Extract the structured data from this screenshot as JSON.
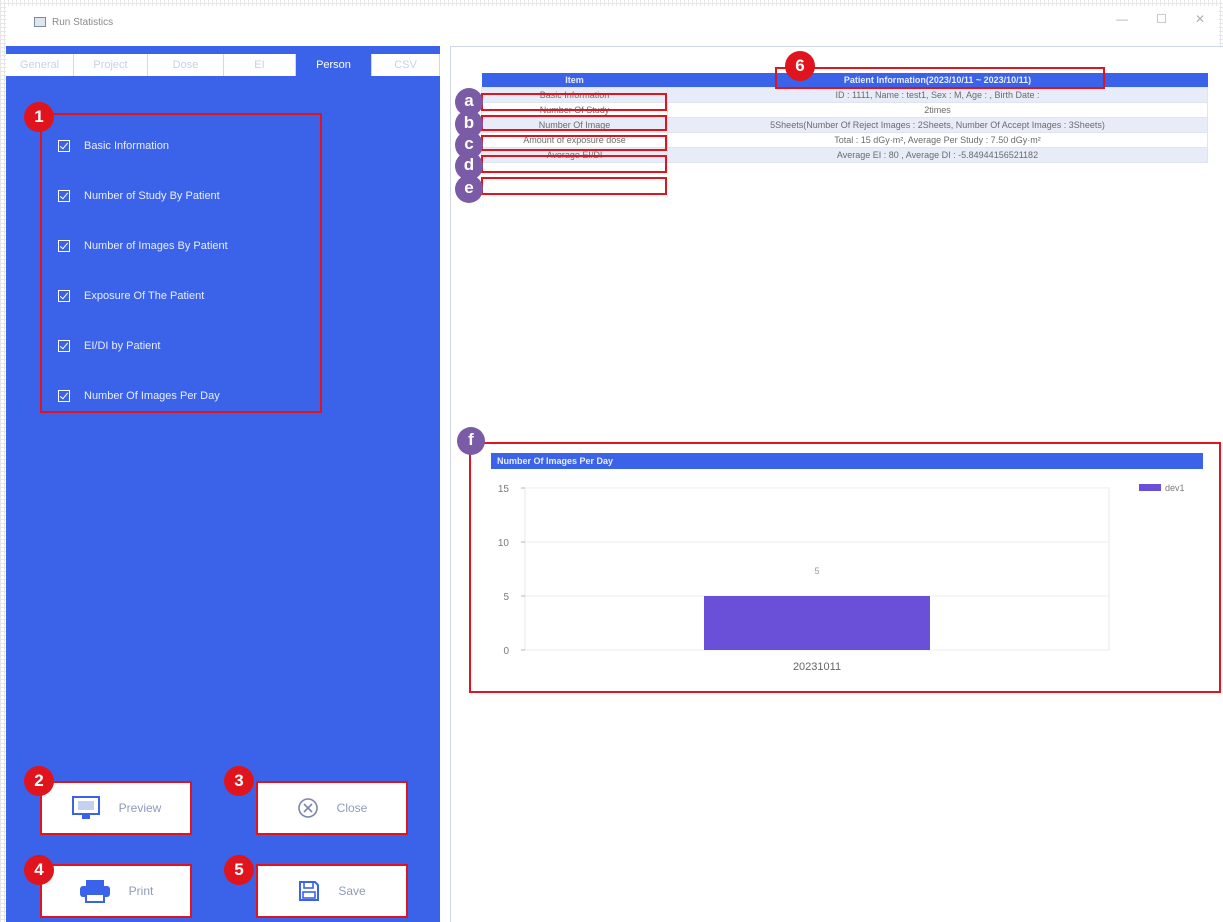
{
  "window": {
    "title": "Run Statistics",
    "controls": [
      "—",
      "☐",
      "✕"
    ]
  },
  "tabs": [
    {
      "label": "General"
    },
    {
      "label": "Project"
    },
    {
      "label": "Dose"
    },
    {
      "label": "EI"
    },
    {
      "label": "Person"
    },
    {
      "label": "CSV"
    }
  ],
  "options": [
    {
      "label": "Basic Information"
    },
    {
      "label": "Number of Study By Patient"
    },
    {
      "label": "Number of Images By Patient"
    },
    {
      "label": "Exposure Of The Patient"
    },
    {
      "label": "EI/DI by Patient"
    },
    {
      "label": "Number Of Images Per Day"
    }
  ],
  "badges": {
    "options": "1",
    "preview": "2",
    "close": "3",
    "print": "4",
    "save": "5",
    "header": "6",
    "chart": "f"
  },
  "buttons": {
    "preview": "Preview",
    "close": "Close",
    "print": "Print",
    "save": "Save"
  },
  "table": {
    "col_item": "Item",
    "col_info": "Patient Information(2023/10/11 ~ 2023/10/11)",
    "rows": [
      {
        "badge": "a",
        "item": "Basic Information",
        "value": "ID : 1111, Name : test1, Sex : M, Age : , Birth Date :"
      },
      {
        "badge": "b",
        "item": "Number Of Study",
        "value": "2times"
      },
      {
        "badge": "c",
        "item": "Number Of Image",
        "value": "5Sheets(Number Of Reject Images : 2Sheets, Number Of Accept Images : 3Sheets)"
      },
      {
        "badge": "d",
        "item": "Amount of exposure dose",
        "value": "Total : 15 dGy·m², Average Per Study : 7.50 dGy·m²"
      },
      {
        "badge": "e",
        "item": "Average EI/DI",
        "value": "Average EI : 80 , Average DI : -5.84944156521182"
      }
    ]
  },
  "chart_data": {
    "type": "bar",
    "title": "Number Of Images Per Day",
    "categories": [
      "20231011"
    ],
    "series": [
      {
        "name": "dev1",
        "values": [
          5
        ],
        "color": "#6a4fd8"
      }
    ],
    "data_labels": [
      "5"
    ],
    "yticks": [
      0,
      5,
      10,
      15
    ],
    "ylim": [
      0,
      15
    ],
    "legend": "top-right",
    "grid": true
  }
}
